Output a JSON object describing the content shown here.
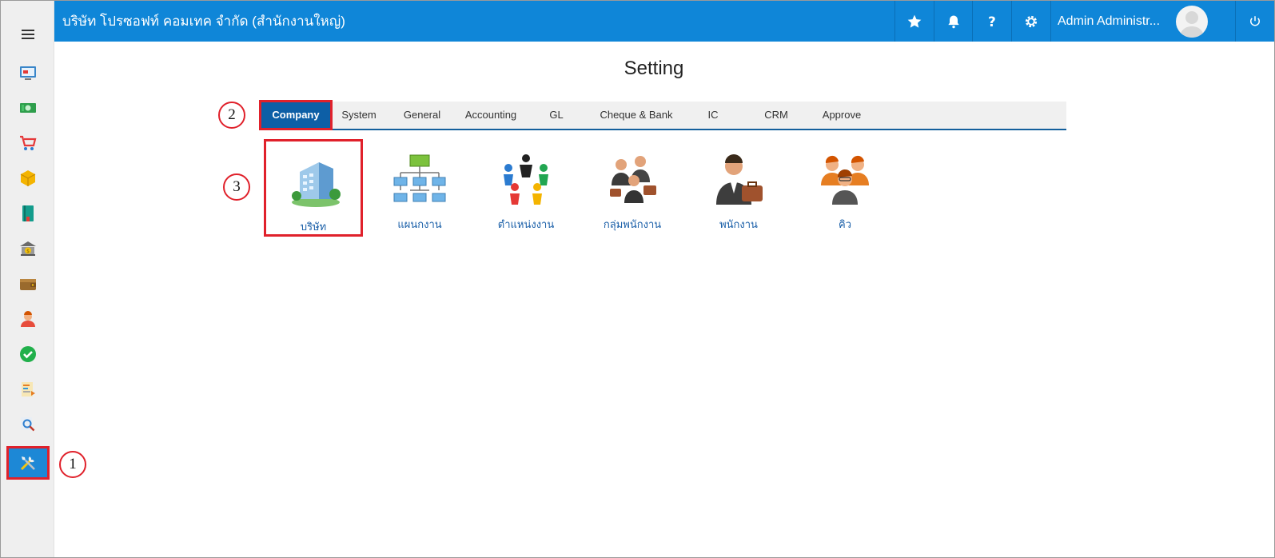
{
  "header": {
    "title": "บริษัท โปรซอฟท์ คอมเทค จำกัด (สำนักงานใหญ่)",
    "user_name": "Admin Administr...",
    "icons": [
      "star-icon",
      "bell-icon",
      "help-icon",
      "gear-icon",
      "power-icon"
    ]
  },
  "sidebar": {
    "items": [
      "dashboard-icon",
      "money-icon",
      "cart-icon",
      "box-icon",
      "book-icon",
      "bank-icon",
      "wallet-icon",
      "person-icon",
      "check-icon",
      "report-icon",
      "search-icon",
      "tools-icon"
    ],
    "active": "tools-icon"
  },
  "page": {
    "title": "Setting"
  },
  "tabs": [
    {
      "label": "Company",
      "active": true
    },
    {
      "label": "System"
    },
    {
      "label": "General"
    },
    {
      "label": "Accounting"
    },
    {
      "label": "GL"
    },
    {
      "label": "Cheque & Bank"
    },
    {
      "label": "IC"
    },
    {
      "label": "CRM"
    },
    {
      "label": "Approve"
    }
  ],
  "cards": [
    {
      "label": "บริษัท",
      "icon": "building-icon",
      "active": true
    },
    {
      "label": "แผนกงาน",
      "icon": "org-chart-icon"
    },
    {
      "label": "ตำแหน่งงาน",
      "icon": "people-circle-icon"
    },
    {
      "label": "กลุ่มพนักงาน",
      "icon": "employee-group-icon"
    },
    {
      "label": "พนักงาน",
      "icon": "employee-icon"
    },
    {
      "label": "คิว",
      "icon": "queue-icon"
    }
  ],
  "markers": [
    "1",
    "2",
    "3"
  ],
  "colors": {
    "header": "#0f86d8",
    "active_tab": "#0d5fa6",
    "highlight": "#e0212b",
    "link": "#1a5fa8"
  }
}
